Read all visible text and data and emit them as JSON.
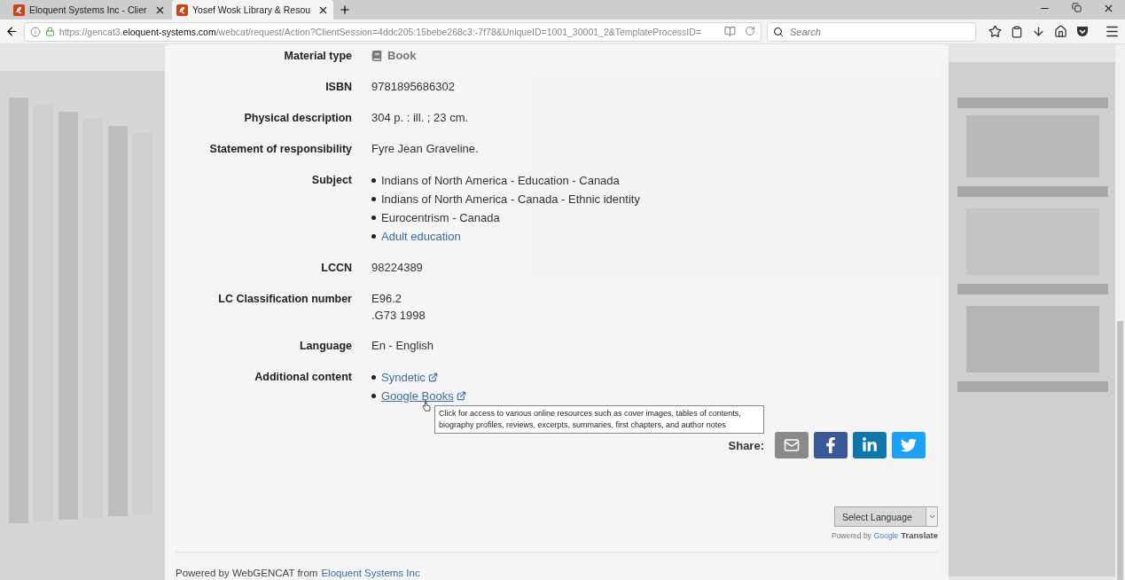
{
  "tabs": [
    {
      "title": "Eloquent Systems Inc - Clier",
      "selected": false
    },
    {
      "title": "Yosef Wosk Library & Resou",
      "selected": true
    }
  ],
  "address": {
    "scheme": "https://gencat3.",
    "domain": "eloquent-systems.com",
    "path": "/webcat/request/Action?ClientSession=4ddc205:15bebe268c3:-7f78&UniqueID=1001_30001_2&TemplateProcessID="
  },
  "search": {
    "placeholder": "Search"
  },
  "record": [
    {
      "label": "Material type",
      "kind": "material",
      "lines": [
        "Book"
      ]
    },
    {
      "label": "ISBN",
      "kind": "text",
      "lines": [
        "9781895686302"
      ]
    },
    {
      "label": "Physical description",
      "kind": "text",
      "lines": [
        "304 p. : ill. ; 23 cm."
      ]
    },
    {
      "label": "Statement of responsibility",
      "kind": "text",
      "lines": [
        "Fyre Jean Graveline."
      ]
    },
    {
      "label": "Subject",
      "kind": "bullets",
      "items": [
        {
          "text": "Indians of North America - Education - Canada",
          "link": false
        },
        {
          "text": "Indians of North America - Canada - Ethnic identity",
          "link": false
        },
        {
          "text": "Eurocentrism - Canada",
          "link": false
        },
        {
          "text": "Adult education",
          "link": true
        }
      ]
    },
    {
      "label": "LCCN",
      "kind": "text",
      "lines": [
        "98224389"
      ]
    },
    {
      "label": "LC Classification number",
      "kind": "text",
      "lines": [
        "E96.2",
        ".G73 1998"
      ]
    },
    {
      "label": "Language",
      "kind": "text",
      "lines": [
        "En - English"
      ]
    },
    {
      "label": "Additional content",
      "kind": "bullets",
      "items": [
        {
          "text": "Syndetic",
          "link": true,
          "external": true,
          "hovered": false
        },
        {
          "text": "Google Books",
          "link": true,
          "external": true,
          "hovered": true
        }
      ]
    }
  ],
  "tooltip": "Click for access to various online resources such as cover images, tables of contents, biography profiles, reviews, excerpts, summaries, first chapters, and author notes",
  "share": {
    "label": "Share:",
    "buttons": [
      {
        "kind": "email"
      },
      {
        "kind": "facebook"
      },
      {
        "kind": "linkedin"
      },
      {
        "kind": "twitter"
      }
    ]
  },
  "translate": {
    "select": "Select Language",
    "powered": "Powered by",
    "brand": "Google",
    "product": "Translate"
  },
  "footer": {
    "text": "Powered by WebGENCAT from",
    "link": "Eloquent Systems Inc"
  }
}
